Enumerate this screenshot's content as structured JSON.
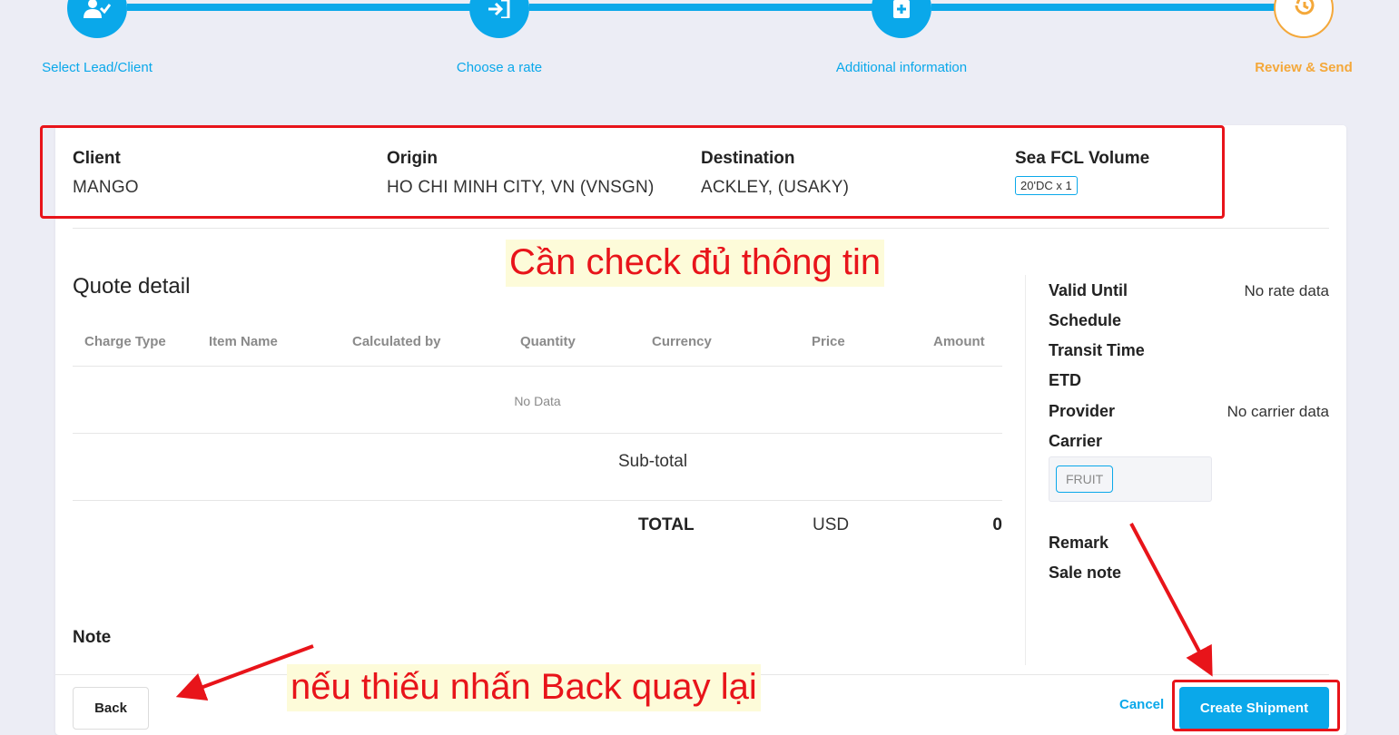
{
  "stepper": {
    "steps": [
      {
        "label": "Select Lead/Client",
        "icon": "user-check-icon",
        "state": "done"
      },
      {
        "label": "Choose a rate",
        "icon": "sign-in-icon",
        "state": "done"
      },
      {
        "label": "Additional information",
        "icon": "document-plus-icon",
        "state": "done"
      },
      {
        "label": "Review & Send",
        "icon": "history-clock-icon",
        "state": "active"
      }
    ]
  },
  "summary": {
    "client_label": "Client",
    "client_value": "MANGO",
    "origin_label": "Origin",
    "origin_value": "HO CHI MINH CITY, VN (VNSGN)",
    "destination_label": "Destination",
    "destination_value": "ACKLEY, (USAKY)",
    "volume_label": "Sea FCL Volume",
    "volume_tag": "20'DC x 1"
  },
  "quote": {
    "title": "Quote detail",
    "columns": [
      "Charge Type",
      "Item Name",
      "Calculated by",
      "Quantity",
      "Currency",
      "Price",
      "Amount"
    ],
    "empty_text": "No Data",
    "subtotal_label": "Sub-total",
    "total_label": "TOTAL",
    "total_currency": "USD",
    "total_amount": "0"
  },
  "side_info": {
    "valid_until_label": "Valid Until",
    "valid_until_value": "No rate data",
    "schedule_label": "Schedule",
    "transit_time_label": "Transit Time",
    "etd_label": "ETD",
    "provider_label": "Provider",
    "provider_value": "No carrier data",
    "carrier_label": "Carrier",
    "carrier_tag": "FRUIT",
    "remark_label": "Remark",
    "sale_note_label": "Sale note"
  },
  "note_label": "Note",
  "actions": {
    "back_label": "Back",
    "cancel_label": "Cancel",
    "create_label": "Create Shipment"
  },
  "annotations": {
    "check_text": "Cần check đủ thông tin",
    "back_hint_text": "nếu thiếu nhấn Back quay lại"
  },
  "colors": {
    "primary": "#0aa8ea",
    "active_step": "#f4a83a",
    "annotation_red": "#e8141a",
    "background": "#ecedf5"
  }
}
